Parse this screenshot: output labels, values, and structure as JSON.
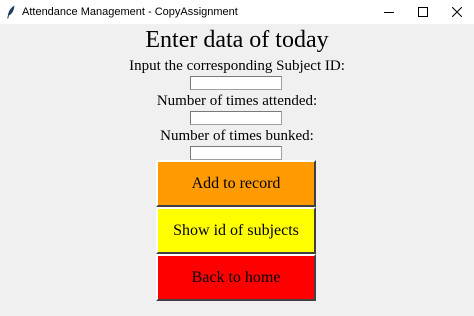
{
  "window": {
    "title": "Attendance Management - CopyAssignment",
    "app_icon": "feather-icon",
    "controls": [
      "minimize-icon",
      "maximize-icon",
      "close-icon"
    ]
  },
  "form": {
    "heading": "Enter data of today",
    "subject_id_label": "Input the corresponding Subject ID:",
    "subject_id_value": "",
    "attended_label": "Number of times attended:",
    "attended_value": "",
    "bunked_label": "Number of times bunked:",
    "bunked_value": ""
  },
  "buttons": {
    "add_label": "Add to record",
    "show_label": "Show id of subjects",
    "back_label": "Back to home"
  },
  "colors": {
    "add": "#ff9a00",
    "show": "#ffff00",
    "back": "#ff0000",
    "background": "#f0f0f0"
  }
}
